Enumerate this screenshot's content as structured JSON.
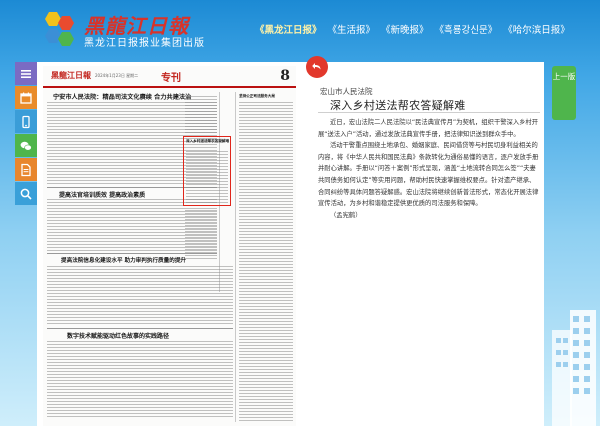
{
  "header": {
    "logo_title": "黑龍江日報",
    "logo_subtitle": "黑龙江日报报业集团出版",
    "nav": [
      {
        "label": "《黑龙江日报》",
        "active": true
      },
      {
        "label": "《生活报》",
        "active": false
      },
      {
        "label": "《新晚报》",
        "active": false
      },
      {
        "label": "《흑룡강신문》",
        "active": false
      },
      {
        "label": "《哈尔滨日报》",
        "active": false
      }
    ]
  },
  "toolbar": {
    "icons": [
      "menu-icon",
      "calendar-icon",
      "phone-icon",
      "wechat-icon",
      "document-icon",
      "search-icon"
    ]
  },
  "paper": {
    "masthead": "黑龍江日報",
    "issue_info": "2024年1月23日 星期二",
    "section": "专刊",
    "page_number": "8",
    "headlines": [
      "宁安市人民法院：精品司法文化赓续 合力共建法治",
      "提高法官培训质效 提高政治素质",
      "提高法院信息化建设水平 助力审判执行质量的提升",
      "数字技术赋能驱动红色故事的实践路径",
      "深入乡村送法帮农答疑解难",
      "坚持公正司法服务大局"
    ]
  },
  "article": {
    "source": "宏山市人民法院",
    "title": "深入乡村送法帮农答疑解难",
    "paragraphs": [
      "近日，宏山法院二人民法院以“民法典宣传月”为契机，组织干警深入乡村开展“送法入户”活动，通过发放法典宣传手册，把法律知识送到群众手中。",
      "活动干警重点围绕土地承包、婚姻家庭、民间借贷等与村民切身利益相关的内容，将《中华人民共和国民法典》条款转化为通俗易懂的语言，逐户发放手册并耐心讲解。手册以“问答＋案例”形式呈现，涵盖“土地流转合同怎么签”“夫妻共同债务如何认定”等实用问题，帮助村民快速掌握维权要点。针对遗产继承、合同纠纷等具体问题答疑解惑。宏山法院将继续创新普法形式，常态化开展法律宣传活动，为乡村和谐稳定提供更优质的司法服务和保障。",
      "（孟宪鹤）"
    ]
  },
  "side": {
    "page_switch": "上一版"
  },
  "colors": {
    "accent_red": "#e2382c",
    "brand_green": "#4fb54c",
    "sky_blue": "#1c8ad4"
  }
}
